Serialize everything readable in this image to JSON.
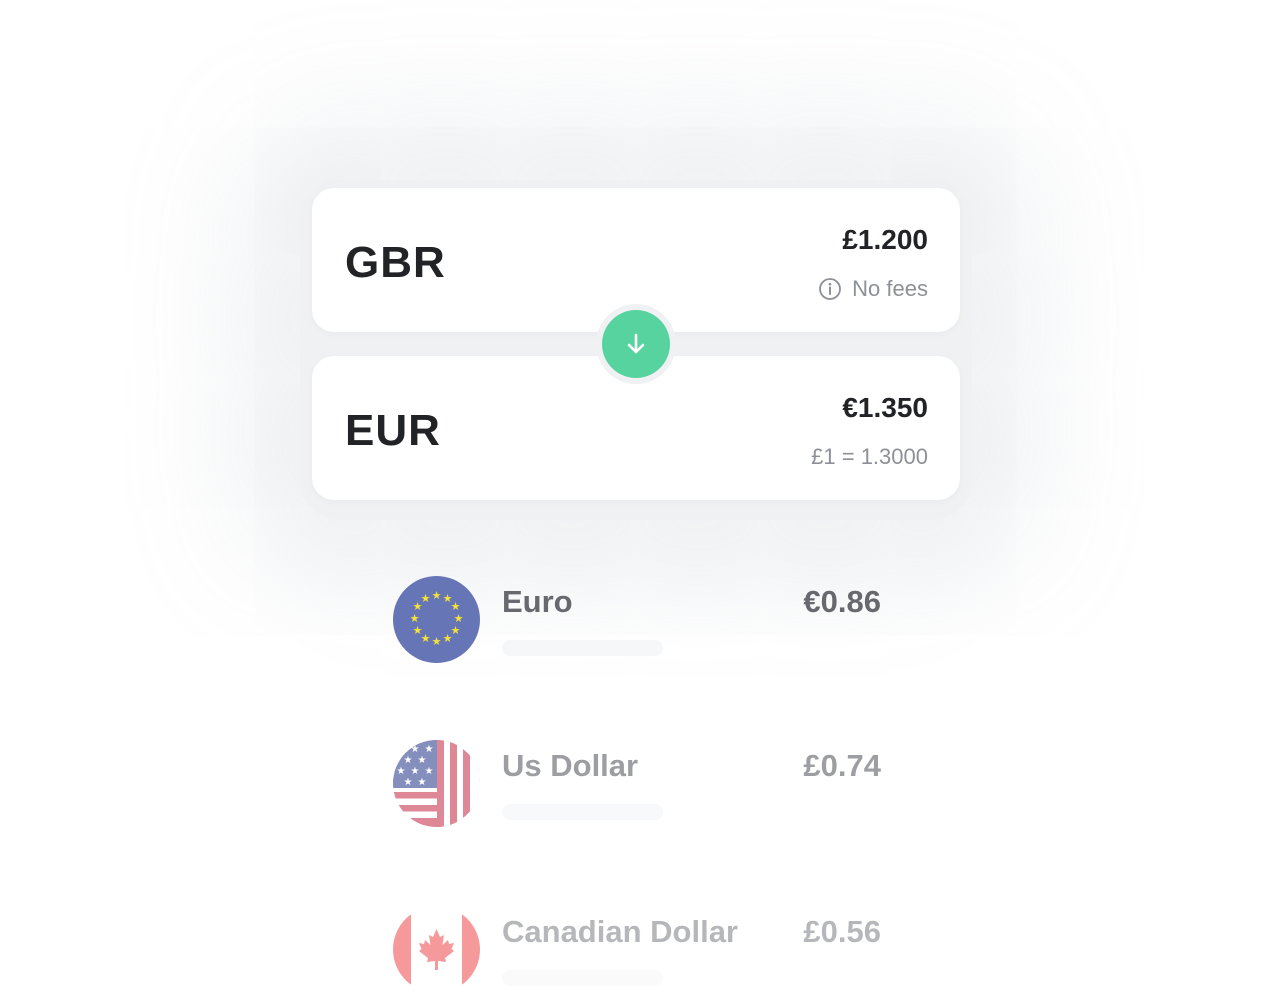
{
  "converter": {
    "from": {
      "code": "GBR",
      "amount": "£1.200",
      "note": "No fees",
      "note_icon": "info-icon"
    },
    "swap_icon": "arrow-down-icon",
    "to": {
      "code": "EUR",
      "amount": "€1.350",
      "rate": "£1 = 1.3000"
    }
  },
  "currencies": [
    {
      "name": "Euro",
      "value": "€0.86",
      "flag": "eu-flag-icon"
    },
    {
      "name": "Us Dollar",
      "value": "£0.74",
      "flag": "us-flag-icon"
    },
    {
      "name": "Canadian Dollar",
      "value": "£0.56",
      "flag": "canada-flag-icon"
    }
  ],
  "colors": {
    "accent": "#57d39f",
    "text_primary": "#222326",
    "text_secondary": "#8d9096",
    "list_text": "#67696e"
  }
}
